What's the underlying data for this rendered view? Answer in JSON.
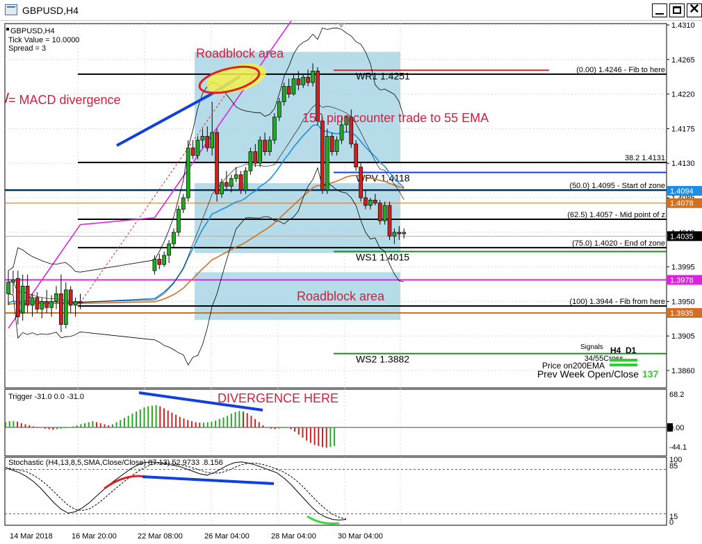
{
  "window": {
    "title": "GBPUSD,H4"
  },
  "info": {
    "symbol": "GBPUSD,H4",
    "tick_value": "Tick Value = 10.0000",
    "spread": "Spread = 3"
  },
  "colors": {
    "bull": "#22aa22",
    "bear": "#cc2222",
    "zone": "#add8e6",
    "ema_fast": "#1e8fe0",
    "ema_mid": "#d07020",
    "ema_slow": "#e020e0",
    "annotation": "#d0203c",
    "pivot": "#1040e0"
  },
  "chart_data": [
    {
      "type": "candlestick",
      "price_axis": {
        "min": 1.385,
        "max": 1.432,
        "ticks": [
          "1.4310",
          "1.4265",
          "1.4220",
          "1.4175",
          "1.4130",
          "1.4085",
          "1.4040",
          "1.3995",
          "1.3950",
          "1.3905",
          "1.3860"
        ]
      },
      "time_axis": {
        "labels": [
          "14 Mar 2018",
          "16 Mar 20:00",
          "22 Mar 08:00",
          "26 Mar 04:00",
          "28 Mar 04:00",
          "30 Mar 04:00"
        ]
      },
      "candles": [
        [
          1.396,
          1.399,
          1.3945,
          1.3975
        ],
        [
          1.3975,
          1.399,
          1.396,
          1.3978
        ],
        [
          1.398,
          1.399,
          1.392,
          1.393
        ],
        [
          1.3935,
          1.3985,
          1.3925,
          1.397
        ],
        [
          1.397,
          1.3985,
          1.3935,
          1.3945
        ],
        [
          1.3945,
          1.396,
          1.393,
          1.3955
        ],
        [
          1.3955,
          1.3962,
          1.3935,
          1.394
        ],
        [
          1.394,
          1.3955,
          1.3928,
          1.395
        ],
        [
          1.395,
          1.3965,
          1.3935,
          1.3942
        ],
        [
          1.3942,
          1.3958,
          1.393,
          1.395
        ],
        [
          1.395,
          1.397,
          1.394,
          1.396
        ],
        [
          1.396,
          1.3985,
          1.391,
          1.392
        ],
        [
          1.392,
          1.3975,
          1.3915,
          1.3965
        ],
        [
          1.3965,
          1.397,
          1.3935,
          1.3945
        ],
        [
          1.3945,
          1.3955,
          1.393,
          1.395
        ],
        [
          1.395,
          1.396,
          1.394,
          1.3948
        ],
        [
          1.399,
          1.401,
          1.3985,
          1.4005
        ],
        [
          1.4005,
          1.4012,
          1.3992,
          1.3998
        ],
        [
          1.3998,
          1.4015,
          1.3995,
          1.401
        ],
        [
          1.401,
          1.403,
          1.4,
          1.4025
        ],
        [
          1.4025,
          1.4045,
          1.402,
          1.404
        ],
        [
          1.404,
          1.4075,
          1.4035,
          1.407
        ],
        [
          1.407,
          1.409,
          1.4065,
          1.4085
        ],
        [
          1.4085,
          1.416,
          1.408,
          1.415
        ],
        [
          1.415,
          1.416,
          1.4135,
          1.414
        ],
        [
          1.414,
          1.4165,
          1.4135,
          1.416
        ],
        [
          1.416,
          1.4175,
          1.415,
          1.4165
        ],
        [
          1.4165,
          1.4178,
          1.4145,
          1.415
        ],
        [
          1.415,
          1.421,
          1.414,
          1.417
        ],
        [
          1.417,
          1.4175,
          1.408,
          1.409
        ],
        [
          1.409,
          1.411,
          1.4085,
          1.4105
        ],
        [
          1.4105,
          1.412,
          1.4095,
          1.41
        ],
        [
          1.41,
          1.4115,
          1.4092,
          1.411
        ],
        [
          1.411,
          1.4125,
          1.4105,
          1.4115
        ],
        [
          1.4115,
          1.412,
          1.409,
          1.4095
        ],
        [
          1.4095,
          1.4125,
          1.409,
          1.412
        ],
        [
          1.412,
          1.415,
          1.4115,
          1.4145
        ],
        [
          1.4145,
          1.4155,
          1.4125,
          1.413
        ],
        [
          1.413,
          1.4165,
          1.4125,
          1.416
        ],
        [
          1.416,
          1.417,
          1.414,
          1.4145
        ],
        [
          1.4145,
          1.4165,
          1.414,
          1.416
        ],
        [
          1.416,
          1.4195,
          1.4155,
          1.419
        ],
        [
          1.419,
          1.4215,
          1.4185,
          1.421
        ],
        [
          1.421,
          1.4235,
          1.4205,
          1.423
        ],
        [
          1.423,
          1.424,
          1.4215,
          1.422
        ],
        [
          1.422,
          1.4245,
          1.4218,
          1.424
        ],
        [
          1.424,
          1.425,
          1.4225,
          1.4232
        ],
        [
          1.4232,
          1.4245,
          1.4228,
          1.4242
        ],
        [
          1.4242,
          1.4252,
          1.423,
          1.4235
        ],
        [
          1.4235,
          1.426,
          1.423,
          1.425
        ],
        [
          1.425,
          1.4255,
          1.418,
          1.4185
        ],
        [
          1.4185,
          1.419,
          1.409,
          1.4095
        ],
        [
          1.4095,
          1.4175,
          1.409,
          1.4165
        ],
        [
          1.4165,
          1.417,
          1.414,
          1.4145
        ],
        [
          1.4145,
          1.4165,
          1.414,
          1.416
        ],
        [
          1.416,
          1.419,
          1.4155,
          1.418
        ],
        [
          1.418,
          1.4192,
          1.417,
          1.419
        ],
        [
          1.419,
          1.42,
          1.415,
          1.4155
        ],
        [
          1.4155,
          1.416,
          1.412,
          1.4125
        ],
        [
          1.4125,
          1.413,
          1.408,
          1.4085
        ],
        [
          1.4085,
          1.4095,
          1.407,
          1.4075
        ],
        [
          1.4075,
          1.4085,
          1.407,
          1.4082
        ],
        [
          1.4082,
          1.409,
          1.4075,
          1.4078
        ],
        [
          1.4078,
          1.4082,
          1.405,
          1.4055
        ],
        [
          1.4055,
          1.408,
          1.405,
          1.4075
        ],
        [
          1.4075,
          1.408,
          1.403,
          1.4035
        ],
        [
          1.4035,
          1.4045,
          1.4025,
          1.404
        ],
        [
          1.404,
          1.4048,
          1.403,
          1.4038
        ],
        [
          1.4038,
          1.4045,
          1.4032,
          1.404
        ]
      ],
      "levels": [
        {
          "label": "(0.00)    1.4246  -  Fib to here",
          "price": 1.4246,
          "color": "#000000"
        },
        {
          "label": "38.2     1.4131",
          "price": 1.4131,
          "color": "#000000"
        },
        {
          "label": "(50.0)   1.4095  -  Start of zone",
          "price": 1.4095,
          "color": "#000000"
        },
        {
          "label": "(62.5)   1.4057  -  Mid point of z",
          "price": 1.4057,
          "color": "#000000"
        },
        {
          "label": "(75.0)   1.4020  -  End of zone",
          "price": 1.402,
          "color": "#000000"
        },
        {
          "label": "(100)    1.3944  -  Fib from here",
          "price": 1.3944,
          "color": "#000000"
        }
      ],
      "pivots": [
        {
          "label": "WR1   1.4251",
          "price": 1.4251,
          "color": "#dd2222"
        },
        {
          "label": "WPV   1.4118",
          "price": 1.4118,
          "color": "#1040e0"
        },
        {
          "label": "WS1   1.4015",
          "price": 1.4015,
          "color": "#228822"
        },
        {
          "label": "WS2   1.3882",
          "price": 1.3882,
          "color": "#228822"
        }
      ],
      "price_tags": [
        {
          "label": "1.4094",
          "price": 1.4094,
          "color": "#1e8fe0"
        },
        {
          "label": "1.4078",
          "price": 1.4078,
          "color": "#d07020"
        },
        {
          "label": "1.4035",
          "price": 1.4035,
          "color": "#000000"
        },
        {
          "label": "1.3978",
          "price": 1.3978,
          "color": "#e020e0"
        },
        {
          "label": "1.3935",
          "price": 1.3935,
          "color": "#d07020"
        }
      ],
      "annotations": {
        "roadblock_top": "Roadblock area",
        "roadblock_bottom": "Roadblock area",
        "macd_divergence": "= MACD divergence",
        "counter_trade": "150 pips counter trade to 55 EMA"
      },
      "signals": {
        "title": "Signals",
        "columns": [
          "H4",
          "D1"
        ],
        "rows": [
          "34/55Cross",
          "Price on200EMA",
          "Prev Week Open/Close"
        ],
        "prev_week_value": "137"
      }
    },
    {
      "type": "histogram",
      "title": "Trigger -31.0 0.0 -31.0",
      "axis_labels": [
        "68.2",
        "0.00",
        "-44.1"
      ],
      "ylim": [
        -44.1,
        68.2
      ],
      "annotation": "DIVERGENCE HERE",
      "values": [
        10,
        12,
        12,
        11,
        8,
        6,
        4,
        2,
        1,
        0,
        -2,
        -3,
        -4,
        -3,
        -2,
        -1,
        0,
        2,
        4,
        6,
        8,
        10,
        12,
        10,
        8,
        6,
        4,
        6,
        10,
        14,
        18,
        22,
        26,
        30,
        34,
        38,
        40,
        41,
        42,
        40,
        36,
        32,
        28,
        24,
        20,
        17,
        14,
        12,
        10,
        9,
        9,
        10,
        11,
        13,
        16,
        19,
        22,
        26,
        29,
        31,
        30,
        27,
        22,
        16,
        10,
        4,
        0,
        -2,
        -3,
        -2,
        -1,
        -1,
        -3,
        -7,
        -12,
        -17,
        -22,
        -26,
        -29,
        -31,
        -33,
        -34,
        -33,
        -31
      ]
    },
    {
      "type": "line",
      "title": "Stochastic (H4,13,8,5,SMA,Close/Close) 87.13) 52.9733 .8.156",
      "axis_labels": [
        "100",
        "85",
        "15",
        "0"
      ],
      "ylim": [
        0,
        100
      ]
    }
  ]
}
